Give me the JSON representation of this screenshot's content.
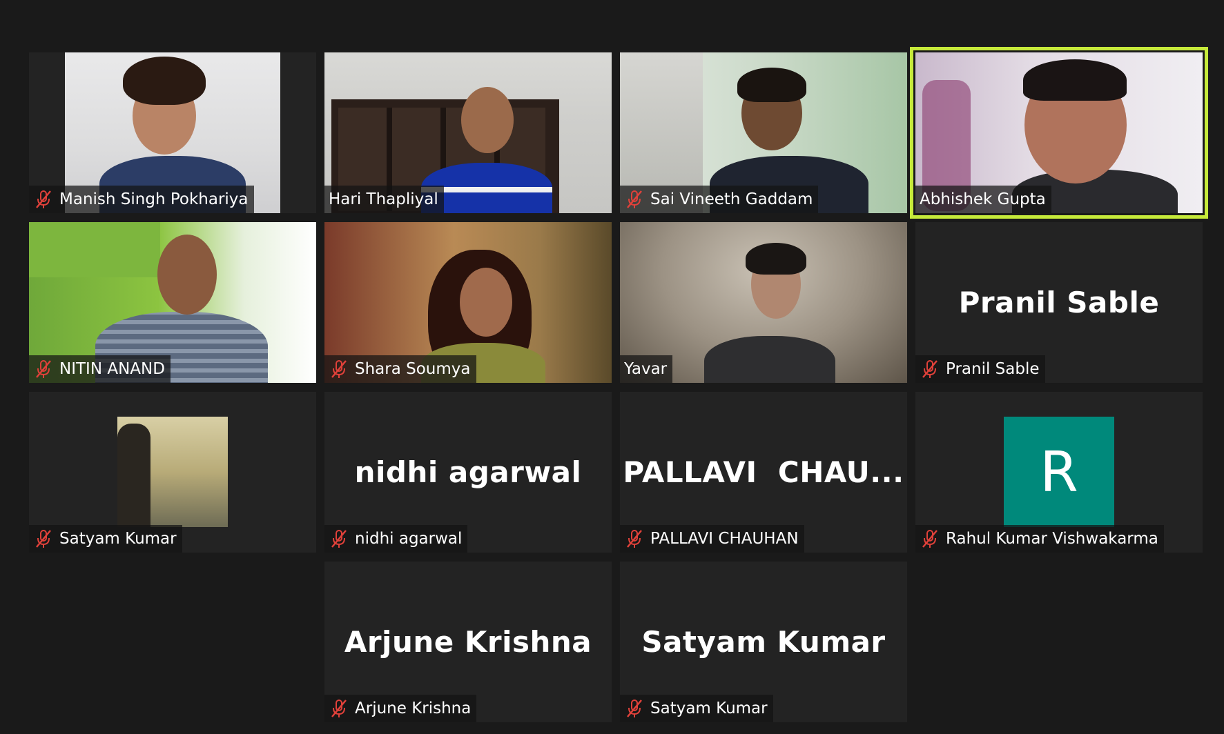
{
  "participants": [
    {
      "name": "Manish Singh Pokhariya",
      "muted": true
    },
    {
      "name": "Hari Thapliyal",
      "muted": false
    },
    {
      "name": "Sai Vineeth Gaddam",
      "muted": true
    },
    {
      "name": "Abhishek Gupta",
      "muted": false,
      "speaking": true
    },
    {
      "name": "NITIN ANAND",
      "muted": true
    },
    {
      "name": "Shara Soumya",
      "muted": true
    },
    {
      "name": "Yavar",
      "muted": false
    },
    {
      "name": "Pranil Sable",
      "display": "Pranil Sable",
      "muted": true
    },
    {
      "name": "Satyam Kumar",
      "muted": true
    },
    {
      "name": "nidhi agarwal",
      "display": "nidhi agarwal",
      "muted": true
    },
    {
      "name": "PALLAVI CHAUHAN",
      "display": "PALLAVI  CHAU...",
      "muted": true
    },
    {
      "name": "Rahul Kumar Vishwakarma",
      "avatar_letter": "R",
      "muted": true
    },
    {
      "name": "Arjune Krishna",
      "display": "Arjune Krishna",
      "muted": true
    },
    {
      "name": "Satyam Kumar",
      "display": "Satyam Kumar",
      "muted": true
    }
  ],
  "colors": {
    "background": "#1a1a1a",
    "tile": "#232323",
    "speaker_border": "#c6ea3a",
    "mic_muted": "#e0413a",
    "avatar_teal": "#00897b"
  },
  "icons": {
    "muted_mic": "mic-muted-icon"
  }
}
